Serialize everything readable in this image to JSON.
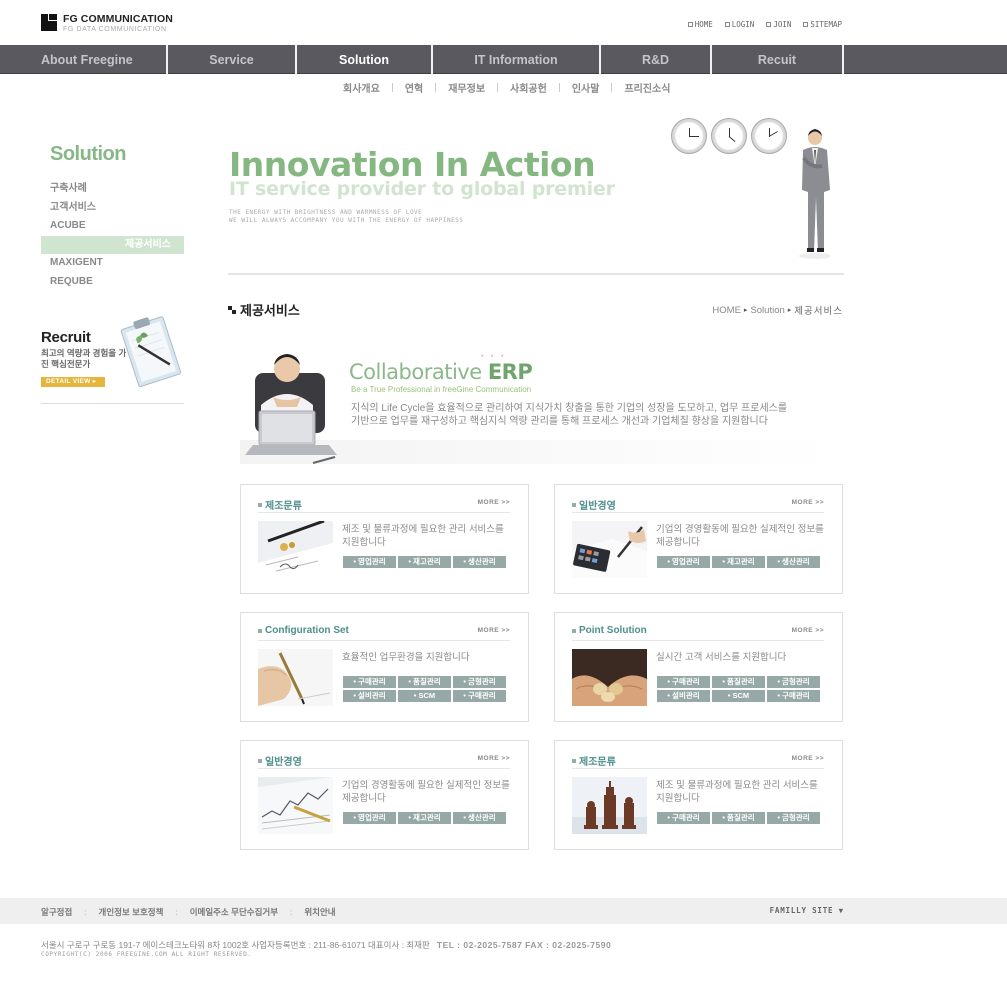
{
  "brand": {
    "name": "FG COMMUNICATION",
    "sub": "FG DATA COMMUNICATION"
  },
  "util_links": [
    "HOME",
    "LOGIN",
    "JOIN",
    "SITEMAP"
  ],
  "gnb": {
    "items": [
      {
        "label": "About Freegine",
        "active": false
      },
      {
        "label": "Service",
        "active": false
      },
      {
        "label": "Solution",
        "active": true
      },
      {
        "label": "IT Information",
        "active": false
      },
      {
        "label": "R&D",
        "active": false
      },
      {
        "label": "Recuit",
        "active": false
      }
    ]
  },
  "sub_gnb": [
    "회사개요",
    "연혁",
    "재무정보",
    "사회공헌",
    "인사말",
    "프리진소식"
  ],
  "lnb": {
    "title": "Solution",
    "items": [
      {
        "label": "구축사례",
        "active": false
      },
      {
        "label": "고객서비스",
        "active": false
      },
      {
        "label": "ACUBE",
        "active": false
      },
      {
        "label": "제공서비스",
        "active": true
      },
      {
        "label": "MAXIGENT",
        "active": false
      },
      {
        "label": "REQUBE",
        "active": false
      }
    ]
  },
  "recruit": {
    "title": "Recruit",
    "desc": "최고의 역량과 경험을 가진 핵심전문가",
    "button": "DETAIL VIEW ▸"
  },
  "hero": {
    "title": "Innovation In Action",
    "subtitle": "IT service provider to global premier",
    "tagline_1": "THE ENERGY WITH BRIGHTNESS AND WARMNESS OF LOVE",
    "tagline_2": "WE WILL ALWAYS ACCOMPANY YOU WITH THE ENERGY OF HAPPINESS"
  },
  "page": {
    "title": "제공서비스",
    "breadcrumb": [
      "HOME",
      "Solution",
      "제공서비스"
    ]
  },
  "erp": {
    "title_a": "Collaborative ",
    "title_b": "ERP",
    "dots": "* * *",
    "slogan": "Be a True Professional in freeGine Communication",
    "desc": "지식의 Life Cycle을 효율적으로 관리하여 지식가치 창출을 통한 기업의 성장을 도모하고, 업무 프로세스를 기반으로 업무를 재구성하고 핵심지식 역량 관리를 통해 프로세스 개선과 기업체질 향상을 지원합니다"
  },
  "cards": [
    {
      "title": "제조문류",
      "more": "MORE >>",
      "desc": "제조 및 물류과정에 필요한 관리 서비스를 지원합니다",
      "tags": [
        "영업관리",
        "재고관리",
        "생산관리"
      ]
    },
    {
      "title": "일반경영",
      "more": "MORE >>",
      "desc": "기업의 경영활동에 필요한 실제적인 정보를 제공합니다",
      "tags": [
        "영업관리",
        "재고관리",
        "생산관리"
      ]
    },
    {
      "title": "Configuration Set",
      "more": "MORE >>",
      "desc": "효율적인 업무환경을 지원합니다",
      "tags": [
        "구매관리",
        "품질관리",
        "금형관리",
        "설비관리",
        "SCM",
        "구매관리"
      ]
    },
    {
      "title": "Point Solution",
      "more": "MORE >>",
      "desc": "실시간 고객 서비스를 지원합니다",
      "tags": [
        "구매관리",
        "품질관리",
        "금형관리",
        "설비관리",
        "SCM",
        "구매관리"
      ]
    },
    {
      "title": "일반경영",
      "more": "MORE >>",
      "desc": "기업의 경영활동에 필요한 실제적인 정보를 제공합니다",
      "tags": [
        "영업관리",
        "재고관리",
        "생산관리"
      ]
    },
    {
      "title": "제조문류",
      "more": "MORE >>",
      "desc": "제조 및 물류과정에 필요한 관리 서비스를 지원합니다",
      "tags": [
        "구매관리",
        "품질관리",
        "금형관리"
      ]
    }
  ],
  "footer": {
    "links": [
      "알구정접",
      "개인정보 보호정책",
      "이메일주소 무단수집거부",
      "위치안내"
    ],
    "family": "FAMILLY SITE ▼",
    "address": "서울시 구로구 구로동 191-7 에이스테크노타워 8차 1002호  사업자등록번호 : 211-86-61071  대표이사 : 최재판",
    "tel": "TEL : 02-2025-7587   FAX : 02-2025-7590",
    "copyright": "COPYRIGHT(C) 2006 FREEGINE.COM ALL RIGHT RESERVED."
  }
}
